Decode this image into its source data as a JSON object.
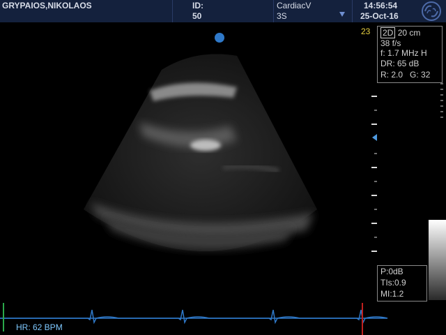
{
  "header": {
    "patient_name": "GRYPAIOS,NIKOLAOS",
    "id_label": "ID:",
    "id_value": "50",
    "preset": "CardiacV",
    "probe": "3S",
    "time": "14:56:54",
    "date": "25-Oct-16",
    "logo_icon": "ge-logo-icon",
    "preset_menu_icon": "triangle-down-icon"
  },
  "params": {
    "frame_number": "23",
    "mode": "2D",
    "depth": "20 cm",
    "frame_rate": "38 f/s",
    "frequency": "f: 1.7 MHz H",
    "dynamic_range": "DR: 65 dB",
    "resolution": "R: 2.0",
    "gain": "G: 32"
  },
  "safety": {
    "power": "P:0dB",
    "tis": "TIs:0.9",
    "mi": "MI:1.2"
  },
  "ecg": {
    "heart_rate": "HR: 62 BPM",
    "trace_color": "#2f79c9"
  },
  "colors": {
    "header_bg": "#14213d",
    "focus_marker": "#2f79c9",
    "frame_number": "#e8d040",
    "hr_text": "#7fc9ff"
  }
}
